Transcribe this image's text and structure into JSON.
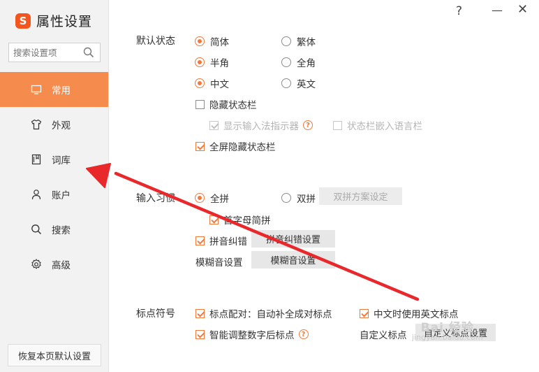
{
  "app": {
    "logo_letter": "S",
    "title": "属性设置"
  },
  "window_controls": {
    "help": "?",
    "minimize": "—",
    "close": "✕"
  },
  "search": {
    "placeholder": "搜索设置项"
  },
  "sidebar": {
    "items": [
      {
        "label": "常用",
        "icon": "monitor-icon",
        "active": true
      },
      {
        "label": "外观",
        "icon": "shirt-icon",
        "active": false
      },
      {
        "label": "词库",
        "icon": "book-icon",
        "active": false
      },
      {
        "label": "账户",
        "icon": "user-icon",
        "active": false
      },
      {
        "label": "搜索",
        "icon": "search-icon",
        "active": false
      },
      {
        "label": "高级",
        "icon": "gear-icon",
        "active": false
      }
    ],
    "reset_label": "恢复本页默认设置"
  },
  "default_state": {
    "label": "默认状态",
    "simplified": "简体",
    "traditional": "繁体",
    "half_width": "半角",
    "full_width": "全角",
    "chinese": "中文",
    "english": "英文",
    "hide_status_bar": "隐藏状态栏",
    "show_indicator": "显示输入法指示器",
    "embed_language_bar": "状态栏嵌入语言栏",
    "fullscreen_hide": "全屏隐藏状态栏"
  },
  "input_habit": {
    "label": "输入习惯",
    "full_pinyin": "全拼",
    "double_pinyin": "双拼",
    "double_pinyin_settings": "双拼方案设定",
    "initial_abbrev": "首字母简拼",
    "pinyin_correction": "拼音纠错",
    "pinyin_correction_settings": "拼音纠错设置",
    "fuzzy_label": "模糊音设置",
    "fuzzy_settings": "模糊音设置"
  },
  "punctuation": {
    "label": "标点符号",
    "auto_pair": "标点配对：自动补全成对标点",
    "english_punct_in_chinese": "中文时使用英文标点",
    "smart_after_digits": "智能调整数字后标点",
    "custom_label": "自定义标点",
    "custom_settings": "自定义标点设置"
  },
  "watermark": {
    "line1": "Bai 经验",
    "line2": "jingyan.baidu.com"
  },
  "colors": {
    "accent": "#f58b4c",
    "annotation_arrow": "#e8282b"
  }
}
